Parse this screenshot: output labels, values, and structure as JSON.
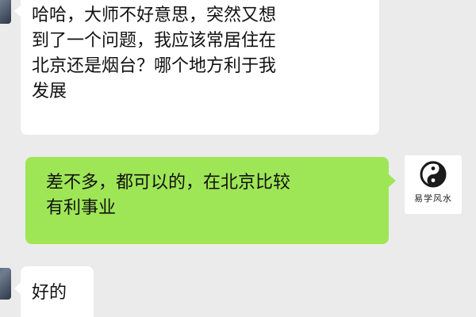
{
  "messages": [
    {
      "side": "left",
      "lines": [
        "哈哈，大师不好意思，突然又想",
        "到了一个问题，我应该常居住在",
        "北京还是烟台？哪个地方利于我",
        "发展"
      ]
    },
    {
      "side": "right",
      "lines": [
        "差不多，都可以的，在北京比较",
        "有利事业"
      ]
    },
    {
      "side": "left",
      "lines": [
        "好的"
      ]
    }
  ],
  "avatars": {
    "right_logo_text": "易学风水",
    "right_logo_icon": "yin-yang-brush-icon"
  },
  "colors": {
    "chat_background": "#ebebeb",
    "incoming_bubble": "#ffffff",
    "outgoing_bubble": "#9fe657"
  }
}
